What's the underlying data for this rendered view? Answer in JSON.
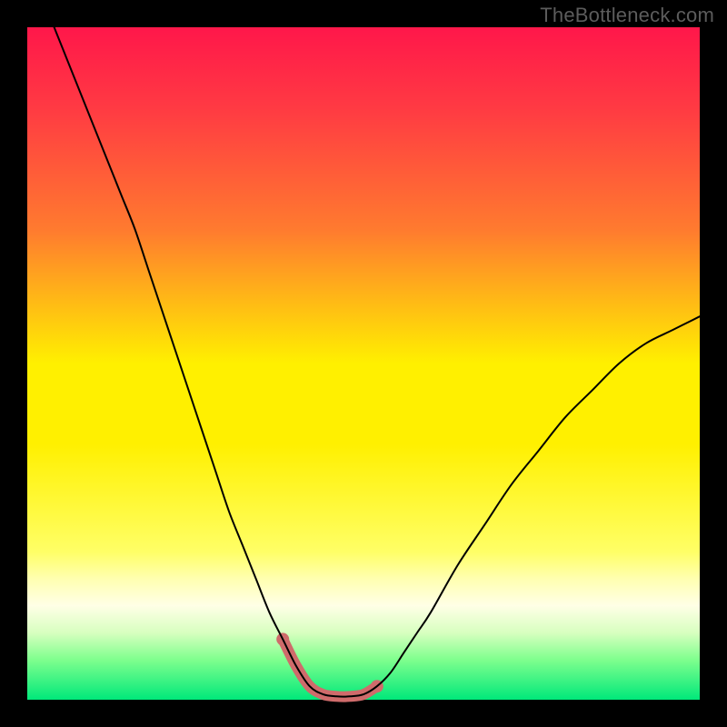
{
  "watermark": "TheBottleneck.com",
  "chart_data": {
    "type": "line",
    "title": "",
    "xlabel": "",
    "ylabel": "",
    "xlim": [
      0,
      100
    ],
    "ylim": [
      0,
      100
    ],
    "grid": false,
    "legend": false,
    "background": {
      "type": "vertical-gradient",
      "stops": [
        {
          "pos": 0.0,
          "color": "#ff174a"
        },
        {
          "pos": 0.12,
          "color": "#ff3a43"
        },
        {
          "pos": 0.3,
          "color": "#ff7a2f"
        },
        {
          "pos": 0.5,
          "color": "#fff000"
        },
        {
          "pos": 0.62,
          "color": "#fff000"
        },
        {
          "pos": 0.78,
          "color": "#ffff66"
        },
        {
          "pos": 0.82,
          "color": "#ffffb0"
        },
        {
          "pos": 0.86,
          "color": "#ffffe6"
        },
        {
          "pos": 0.9,
          "color": "#d8ffc0"
        },
        {
          "pos": 0.94,
          "color": "#80ff8e"
        },
        {
          "pos": 1.0,
          "color": "#00e87a"
        }
      ]
    },
    "series": [
      {
        "name": "bottleneck-curve",
        "color": "#000000",
        "width": 2,
        "x": [
          4,
          6,
          8,
          10,
          12,
          14,
          16,
          18,
          20,
          22,
          24,
          26,
          28,
          30,
          32,
          34,
          36,
          38,
          40,
          42,
          44,
          46,
          48,
          50,
          52,
          54,
          56,
          58,
          60,
          64,
          68,
          72,
          76,
          80,
          84,
          88,
          92,
          96,
          100
        ],
        "y": [
          100,
          95,
          90,
          85,
          80,
          75,
          70,
          64,
          58,
          52,
          46,
          40,
          34,
          28,
          23,
          18,
          13,
          9,
          5,
          2,
          0.8,
          0.5,
          0.5,
          0.8,
          2,
          4,
          7,
          10,
          13,
          20,
          26,
          32,
          37,
          42,
          46,
          50,
          53,
          55,
          57
        ]
      }
    ],
    "highlight": {
      "name": "minimum-band",
      "color": "#cf6b6b",
      "endcap_radius": 7,
      "width": 12,
      "x": [
        38,
        40,
        42,
        44,
        46,
        48,
        50,
        52
      ],
      "y": [
        9,
        5,
        2,
        0.8,
        0.5,
        0.5,
        0.8,
        2
      ]
    }
  }
}
